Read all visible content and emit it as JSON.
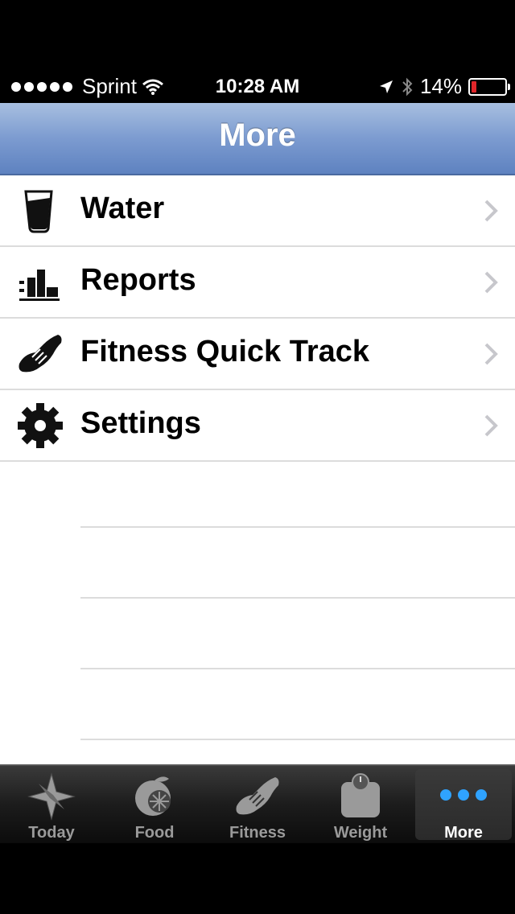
{
  "status": {
    "carrier": "Sprint",
    "time": "10:28 AM",
    "battery": "14%",
    "battery_level": 0.14
  },
  "nav": {
    "title": "More"
  },
  "menu": [
    {
      "label": "Water",
      "icon": "water-glass-icon"
    },
    {
      "label": "Reports",
      "icon": "bar-chart-icon"
    },
    {
      "label": "Fitness Quick Track",
      "icon": "running-shoe-icon"
    },
    {
      "label": "Settings",
      "icon": "gear-icon"
    }
  ],
  "tabs": [
    {
      "label": "Today",
      "icon": "compass-star-icon",
      "active": false
    },
    {
      "label": "Food",
      "icon": "fruit-icon",
      "active": false
    },
    {
      "label": "Fitness",
      "icon": "running-shoe-icon",
      "active": false
    },
    {
      "label": "Weight",
      "icon": "scale-icon",
      "active": false
    },
    {
      "label": "More",
      "icon": "more-dots-icon",
      "active": true
    }
  ],
  "colors": {
    "nav_top": "#a8bfe0",
    "nav_bottom": "#5e82c0",
    "more_dots": "#2fa3ff"
  }
}
